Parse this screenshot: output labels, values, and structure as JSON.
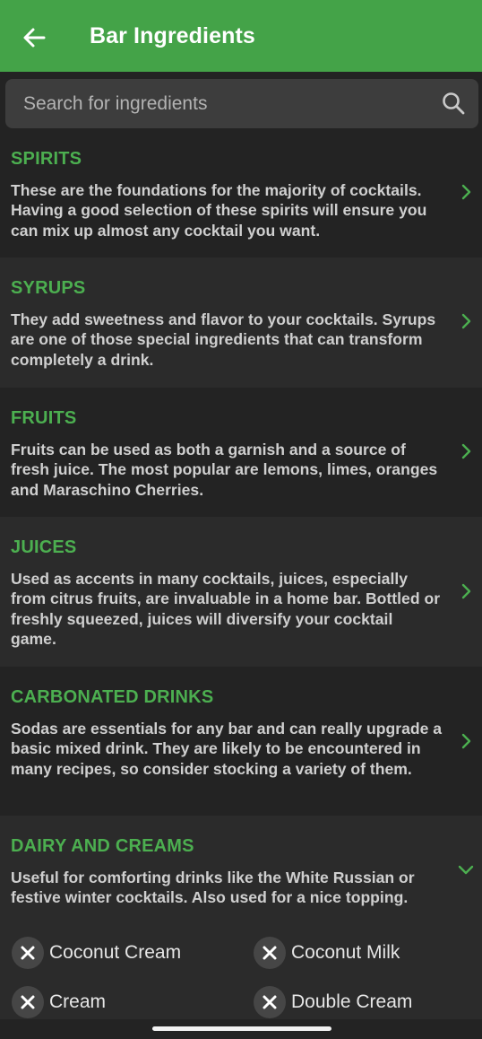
{
  "appbar": {
    "title": "Bar Ingredients"
  },
  "search": {
    "placeholder": "Search for ingredients"
  },
  "categories": [
    {
      "title": "SPIRITS",
      "description": "These are the foundations for the majority of cocktails. Having a good selection of these spirits will ensure you can mix up almost any cocktail you want.",
      "state": "collapsed"
    },
    {
      "title": "SYRUPS",
      "description": "They add sweetness and flavor to your cocktails. Syrups are one of those special ingredients that can transform completely a drink.",
      "state": "collapsed"
    },
    {
      "title": "FRUITS",
      "description": "Fruits can be used as both a garnish and a source of fresh juice. The most popular are lemons, limes, oranges and Maraschino Cherries.",
      "state": "collapsed"
    },
    {
      "title": "JUICES",
      "description": "Used as accents in many cocktails, juices, especially from citrus fruits, are invaluable in a home bar. Bottled or freshly squeezed, juices will diversify your cocktail game.",
      "state": "collapsed"
    },
    {
      "title": "CARBONATED DRINKS",
      "description": "Sodas are essentials for any bar and can really upgrade a basic mixed drink. They are likely to be encountered in many recipes, so consider stocking a variety of them.",
      "state": "collapsed"
    },
    {
      "title": "DAIRY AND CREAMS",
      "description": "Useful for comforting drinks like the White Russian or festive winter cocktails. Also used for a nice topping.",
      "state": "expanded",
      "items": [
        "Coconut Cream",
        "Coconut Milk",
        "Cream",
        "Double Cream"
      ]
    }
  ],
  "icons": {
    "back": "arrow-left-icon",
    "search": "search-icon",
    "collapsed": "chevron-right-icon",
    "expanded": "chevron-down-icon",
    "remove": "close-icon"
  },
  "colors": {
    "accent": "#44a348",
    "title_green": "#4caf50",
    "background": "#232323",
    "row_alt": "#2b2b2b"
  }
}
